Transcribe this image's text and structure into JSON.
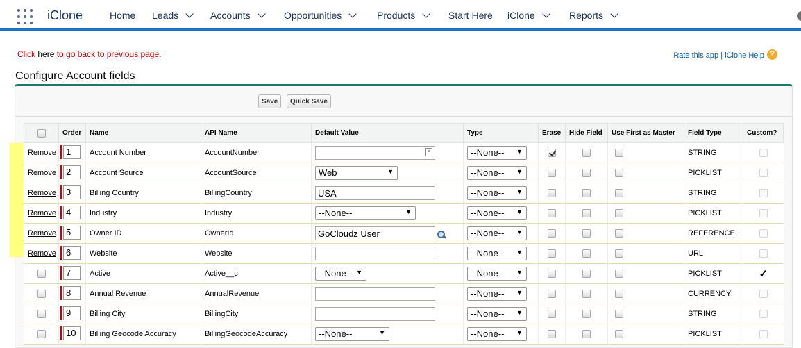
{
  "nav": {
    "app_name": "iClone",
    "items": [
      {
        "label": "Home",
        "has_menu": false
      },
      {
        "label": "Leads",
        "has_menu": true
      },
      {
        "label": "Accounts",
        "has_menu": true
      },
      {
        "label": "Opportunities",
        "has_menu": true
      },
      {
        "label": "Products",
        "has_menu": true
      },
      {
        "label": "Start Here",
        "has_menu": false
      },
      {
        "label": "iClone",
        "has_menu": true
      },
      {
        "label": "Reports",
        "has_menu": true
      }
    ]
  },
  "header": {
    "back_prefix": "Click ",
    "back_link": "here",
    "back_suffix": " to go back to previous page.",
    "rate_link": "Rate this app",
    "separator": " | ",
    "help_link": "iClone Help",
    "help_icon": "?"
  },
  "page_title": "Configure Account fields",
  "buttons": {
    "save": "Save",
    "quick_save": "Quick Save"
  },
  "table": {
    "headers": [
      "",
      "Order",
      "Name",
      "API Name",
      "Default Value",
      "Type",
      "Erase",
      "Hide Field",
      "Use First as Master",
      "Field Type",
      "Custom?"
    ],
    "remove_label": "Remove",
    "custom_mark": "✓",
    "rows": [
      {
        "removable": true,
        "order": "1",
        "name": "Account Number",
        "api": "AccountNumber",
        "default_kind": "text-icon",
        "default_value": "",
        "type": "--None--",
        "erase": true,
        "hide": false,
        "master": false,
        "field_type": "STRING",
        "custom": false
      },
      {
        "removable": true,
        "order": "2",
        "name": "Account Source",
        "api": "AccountSource",
        "default_kind": "select",
        "default_value": "Web",
        "type": "--None--",
        "erase": false,
        "hide": false,
        "master": false,
        "field_type": "PICKLIST",
        "custom": false
      },
      {
        "removable": true,
        "order": "3",
        "name": "Billing Country",
        "api": "BillingCountry",
        "default_kind": "text",
        "default_value": "USA",
        "type": "--None--",
        "erase": false,
        "hide": false,
        "master": false,
        "field_type": "STRING",
        "custom": false
      },
      {
        "removable": true,
        "order": "4",
        "name": "Industry",
        "api": "Industry",
        "default_kind": "select",
        "default_value": "--None--",
        "type": "--None--",
        "erase": false,
        "hide": false,
        "master": false,
        "field_type": "PICKLIST",
        "custom": false
      },
      {
        "removable": true,
        "order": "5",
        "name": "Owner ID",
        "api": "OwnerId",
        "default_kind": "lookup",
        "default_value": "GoCloudz User",
        "type": "--None--",
        "erase": false,
        "hide": false,
        "master": false,
        "field_type": "REFERENCE",
        "custom": false
      },
      {
        "removable": true,
        "order": "6",
        "name": "Website",
        "api": "Website",
        "default_kind": "text",
        "default_value": "",
        "type": "--None--",
        "erase": false,
        "hide": false,
        "master": false,
        "field_type": "URL",
        "custom": false
      },
      {
        "removable": false,
        "order": "7",
        "name": "Active",
        "api": "Active__c",
        "default_kind": "select-small",
        "default_value": "--None--",
        "type": "--None--",
        "erase": false,
        "hide": false,
        "master": false,
        "field_type": "PICKLIST",
        "custom": true
      },
      {
        "removable": false,
        "order": "8",
        "name": "Annual Revenue",
        "api": "AnnualRevenue",
        "default_kind": "text",
        "default_value": "",
        "type": "--None--",
        "erase": false,
        "hide": false,
        "master": false,
        "field_type": "CURRENCY",
        "custom": false
      },
      {
        "removable": false,
        "order": "9",
        "name": "Billing City",
        "api": "BillingCity",
        "default_kind": "text",
        "default_value": "",
        "type": "--None--",
        "erase": false,
        "hide": false,
        "master": false,
        "field_type": "STRING",
        "custom": false
      },
      {
        "removable": false,
        "order": "10",
        "name": "Billing Geocode Accuracy",
        "api": "BillingGeocodeAccuracy",
        "default_kind": "select",
        "default_value": "--None--",
        "type": "--None--",
        "erase": false,
        "hide": false,
        "master": false,
        "field_type": "PICKLIST",
        "custom": false
      }
    ]
  },
  "colors": {
    "nav_accent": "#1b74c9",
    "block_accent": "#1f7a6e",
    "required": "#cc0000",
    "highlight": "#ffff80",
    "link": "#015ba7"
  }
}
